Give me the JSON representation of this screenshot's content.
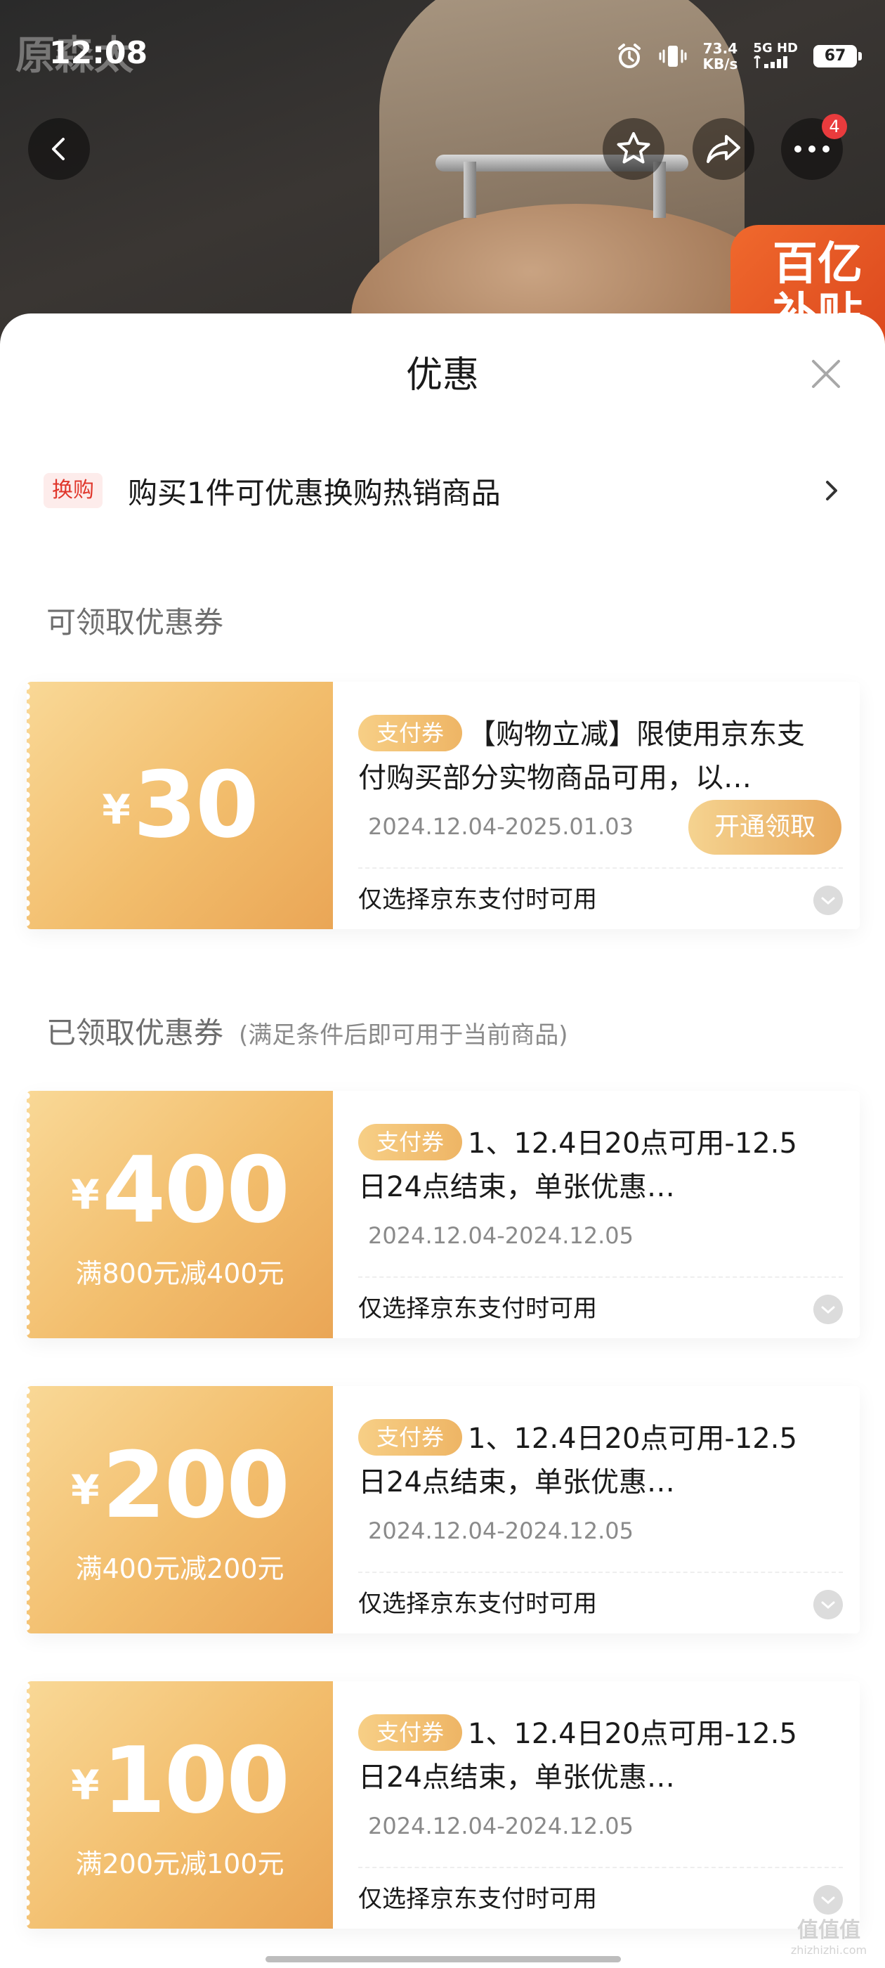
{
  "status_bar": {
    "time": "12:08",
    "net_speed": "73.4",
    "net_unit": "KB/s",
    "signal": "5G HD",
    "battery": "67"
  },
  "watermark": {
    "top_left": "原森太",
    "bottom_right": "值值值",
    "bottom_right_sub": "zhizhizhi.com"
  },
  "hero": {
    "badge_line1": "百亿",
    "badge_line2": "补贴",
    "more_badge_count": "4"
  },
  "sheet": {
    "title": "优惠",
    "swap": {
      "tag": "换购",
      "text": "购买1件可优惠换购热销商品",
      "arrow": "›"
    },
    "available_section_title": "可领取优惠券",
    "claimed_section_title": "已领取优惠券",
    "claimed_section_note": "(满足条件后即可用于当前商品)"
  },
  "available_coupons": [
    {
      "currency": "¥",
      "amount": "30",
      "tag": "支付券",
      "description": "【购物立减】限使用京东支付购买部分实物商品可用，以…",
      "validity": "2024.12.04-2025.01.03",
      "button_label": "开通领取",
      "footer": "仅选择京东支付时可用"
    }
  ],
  "claimed_coupons": [
    {
      "currency": "¥",
      "amount": "400",
      "condition": "满800元减400元",
      "tag": "支付券",
      "description": "1、12.4日20点可用-12.5日24点结束，单张优惠…",
      "validity": "2024.12.04-2024.12.05",
      "footer": "仅选择京东支付时可用"
    },
    {
      "currency": "¥",
      "amount": "200",
      "condition": "满400元减200元",
      "tag": "支付券",
      "description": "1、12.4日20点可用-12.5日24点结束，单张优惠…",
      "validity": "2024.12.04-2024.12.05",
      "footer": "仅选择京东支付时可用"
    },
    {
      "currency": "¥",
      "amount": "100",
      "condition": "满200元减100元",
      "tag": "支付券",
      "description": "1、12.4日20点可用-12.5日24点结束，单张优惠…",
      "validity": "2024.12.04-2024.12.05",
      "footer": "仅选择京东支付时可用"
    }
  ],
  "icons": {
    "back": "chevron-left-icon",
    "favorite": "star-icon",
    "share": "share-icon",
    "more": "more-dots-icon",
    "close": "close-icon",
    "expand": "chevron-down-icon"
  },
  "colors": {
    "coupon_gold": "#f2bd6c",
    "swap_tag_red": "#e0372c",
    "notification_red": "#e93b3d"
  }
}
